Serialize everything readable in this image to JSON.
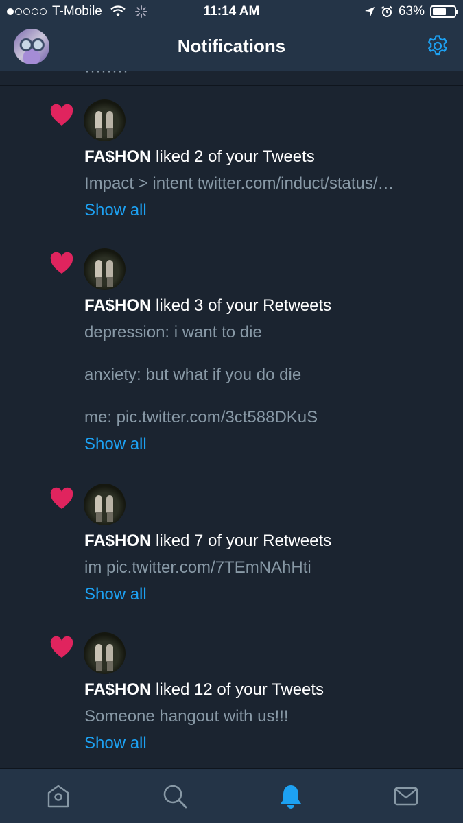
{
  "status_bar": {
    "carrier": "T-Mobile",
    "time": "11:14 AM",
    "battery": "63%",
    "battery_level": 0.63
  },
  "header": {
    "title": "Notifications"
  },
  "notifications": [
    {
      "name": "FA$HON",
      "action": " liked 2 of your Tweets",
      "lines": [
        "Impact > intent twitter.com/induct/status/…"
      ],
      "show_all": "Show all"
    },
    {
      "name": "FA$HON",
      "action": " liked 3 of your Retweets",
      "lines": [
        "depression: i want to die",
        "anxiety: but what if you do die",
        "me: pic.twitter.com/3ct588DKuS"
      ],
      "show_all": "Show all"
    },
    {
      "name": "FA$HON",
      "action": " liked 7 of your Retweets",
      "lines": [
        "im pic.twitter.com/7TEmNAhHti"
      ],
      "show_all": "Show all"
    },
    {
      "name": "FA$HON",
      "action": " liked 12 of your Tweets",
      "lines": [
        "Someone hangout with us!!!"
      ],
      "show_all": "Show all"
    }
  ],
  "tabbar": {
    "items": [
      "home-icon",
      "search-icon",
      "bell-icon",
      "mail-icon"
    ],
    "active": "bell-icon"
  },
  "colors": {
    "background": "#1b2430",
    "header": "#243447",
    "accent": "#1da1f2",
    "heart": "#e0245e",
    "secondary_text": "#8899a6"
  }
}
